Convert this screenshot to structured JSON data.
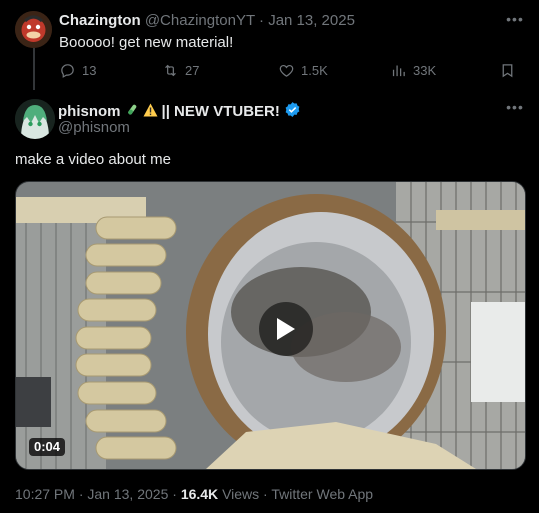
{
  "reply_tweet": {
    "display_name": "Chazington",
    "handle": "@ChazingtonYT",
    "separator": "·",
    "date": "Jan 13, 2025",
    "text": "Booooo! get new material!",
    "stats": {
      "replies": "13",
      "reposts": "27",
      "likes": "1.5K",
      "views": "33K"
    }
  },
  "main_tweet": {
    "display_name": "phisnom",
    "name_suffix": "|| NEW VTUBER!",
    "handle": "@phisnom",
    "verified": true,
    "text": "make a video about me",
    "video": {
      "duration": "0:04"
    },
    "meta": {
      "time": "10:27 PM",
      "separator1": "·",
      "date": "Jan 13, 2025",
      "separator2": "·",
      "views_count": "16.4K",
      "views_label": "Views",
      "separator3": "·",
      "source": "Twitter Web App"
    }
  },
  "colors": {
    "background": "#000000",
    "text_primary": "#e7e9ea",
    "text_muted": "#71767b",
    "verified_blue": "#1d9bf0",
    "thread_line": "#333639"
  }
}
